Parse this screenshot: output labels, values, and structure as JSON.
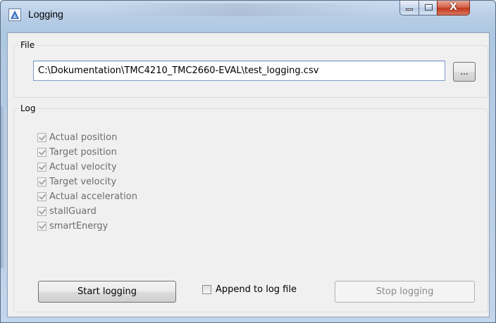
{
  "window": {
    "title": "Logging",
    "close_glyph": "X"
  },
  "file_group": {
    "legend": "File",
    "path_value": "C:\\Dokumentation\\TMC4210_TMC2660-EVAL\\test_logging.csv",
    "browse_label": "..."
  },
  "log_group": {
    "legend": "Log",
    "items": [
      {
        "label": "Actual position",
        "checked": true,
        "enabled": false
      },
      {
        "label": "Target position",
        "checked": true,
        "enabled": false
      },
      {
        "label": "Actual velocity",
        "checked": true,
        "enabled": false
      },
      {
        "label": "Target velocity",
        "checked": true,
        "enabled": false
      },
      {
        "label": "Actual acceleration",
        "checked": true,
        "enabled": false
      },
      {
        "label": "stallGuard",
        "checked": true,
        "enabled": false
      },
      {
        "label": "smartEnergy",
        "checked": true,
        "enabled": false
      }
    ]
  },
  "actions": {
    "start_label": "Start logging",
    "append_label": "Append to log file",
    "append_checked": false,
    "stop_label": "Stop logging",
    "stop_enabled": false
  },
  "icons": {
    "app": "app-logo-icon",
    "minimize": "minimize-icon",
    "maximize": "maximize-icon",
    "close": "close-icon"
  }
}
